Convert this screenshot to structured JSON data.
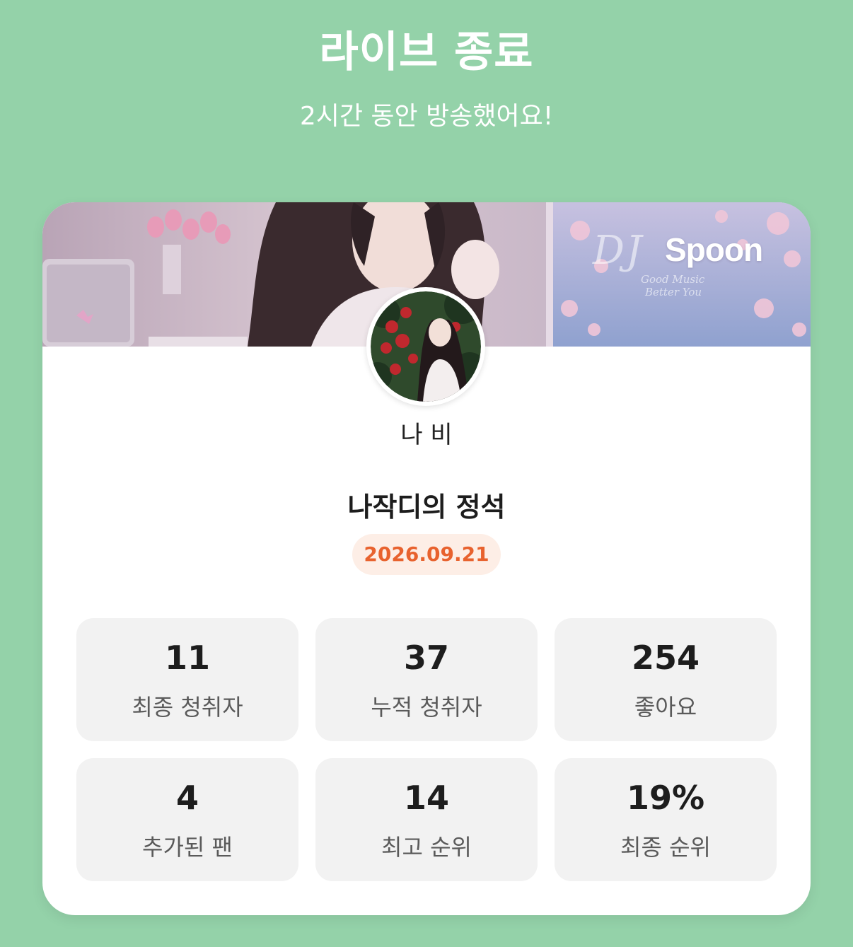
{
  "header": {
    "title": "라이브 종료",
    "subtitle": "2시간 동안 방송했어요!"
  },
  "banner": {
    "brand": "Spoon",
    "dj_text": "DJ",
    "tagline_1": "Good Music",
    "tagline_2": "Better You"
  },
  "profile": {
    "nickname": "나 비"
  },
  "live": {
    "title": "나작디의 정석",
    "date": "2026.09.21"
  },
  "stats": [
    {
      "value": "11",
      "label": "최종 청취자"
    },
    {
      "value": "37",
      "label": "누적 청취자"
    },
    {
      "value": "254",
      "label": "좋아요"
    },
    {
      "value": "4",
      "label": "추가된 팬"
    },
    {
      "value": "14",
      "label": "최고 순위"
    },
    {
      "value": "19%",
      "label": "최종 순위"
    }
  ],
  "colors": {
    "background": "#94d2a9",
    "card": "#ffffff",
    "date_text": "#e8622e",
    "date_pill": "#fdeee6",
    "stat_tile": "#f2f2f2"
  }
}
